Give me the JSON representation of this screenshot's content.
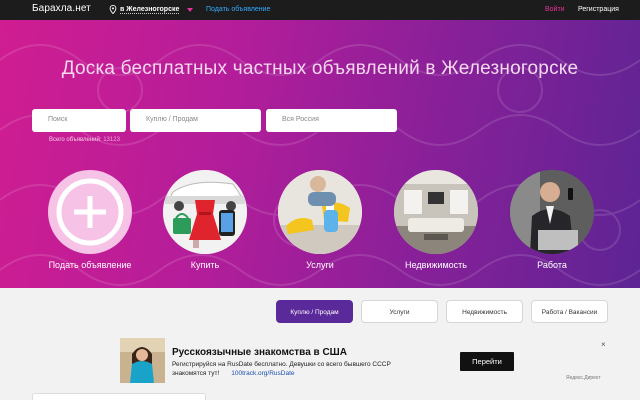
{
  "topbar": {
    "logo": "Барахла.нет",
    "city": "в Железногорске",
    "post_ad": "Подать объявление",
    "login": "Войти",
    "register": "Регистрация"
  },
  "hero": {
    "title": "Доска бесплатных частных объявлений в Железногорске",
    "search_placeholder": "Поиск",
    "type_placeholder": "Куплю / Продам",
    "region_placeholder": "Вся Россия",
    "total_label": "Всего объявлений:",
    "total_count": "13123"
  },
  "categories": [
    {
      "label": "Подать объявление"
    },
    {
      "label": "Купить"
    },
    {
      "label": "Услуги"
    },
    {
      "label": "Недвижимость"
    },
    {
      "label": "Работа"
    }
  ],
  "tabs": [
    {
      "label": "Куплю / Продам",
      "active": true
    },
    {
      "label": "Услуги",
      "active": false
    },
    {
      "label": "Недвижимость",
      "active": false
    },
    {
      "label": "Работа / Вакансии",
      "active": false
    }
  ],
  "ad": {
    "title": "Русскоязычные знакомства в США",
    "text": "Регистрируйся на RusDate бесплатно. Девушки со всего бывшего СССР знакомятся тут!",
    "link": "100track.org/RusDate",
    "button": "Перейти",
    "brand": "Яндекс.Директ",
    "close": "×"
  },
  "colors": {
    "accent": "#e6309b",
    "link": "#33aaff",
    "active_tab": "#5b2a9a"
  }
}
